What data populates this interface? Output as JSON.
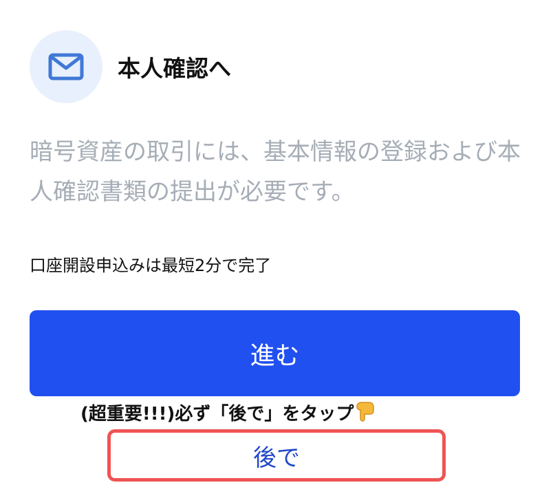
{
  "header": {
    "icon": "mail-icon",
    "title": "本人確認へ"
  },
  "description": "暗号資産の取引には、基本情報の登録および本人確認書類の提出が必要です。",
  "note": "口座開設申込みは最短2分で完了",
  "proceed_button": {
    "label": "進む"
  },
  "annotation": {
    "text": "(超重要!!!)必ず「後で」をタップ",
    "icon": "pointing-down-icon"
  },
  "later_button": {
    "label": "後で"
  },
  "colors": {
    "accent": "#2150f0",
    "highlight": "#ef5454",
    "icon_bg": "#e8f0fd",
    "link": "#2148c8",
    "muted_text": "#a6adb6"
  }
}
